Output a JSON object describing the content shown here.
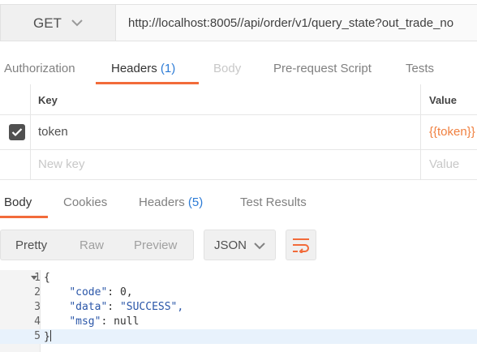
{
  "request": {
    "method": "GET",
    "url": "http://localhost:8005//api/order/v1/query_state?out_trade_no"
  },
  "request_tabs": [
    {
      "label": "Authorization"
    },
    {
      "label": "Headers",
      "count": "(1)"
    },
    {
      "label": "Body"
    },
    {
      "label": "Pre-request Script"
    },
    {
      "label": "Tests"
    }
  ],
  "headers_table": {
    "col_key": "Key",
    "col_value": "Value",
    "rows": [
      {
        "key": "token",
        "value": "{{token}}",
        "checked": true
      }
    ],
    "new_key_placeholder": "New key",
    "new_value_placeholder": "Value"
  },
  "response_tabs": [
    {
      "label": "Body"
    },
    {
      "label": "Cookies"
    },
    {
      "label": "Headers",
      "count": "(5)"
    },
    {
      "label": "Test Results"
    }
  ],
  "view_options": [
    "Pretty",
    "Raw",
    "Preview"
  ],
  "format": "JSON",
  "code_lines": [
    {
      "num": "1",
      "text": "{"
    },
    {
      "num": "2",
      "key": "\"code\"",
      "value": "0,"
    },
    {
      "num": "3",
      "key": "\"data\"",
      "value": "\"SUCCESS\","
    },
    {
      "num": "4",
      "key": "\"msg\"",
      "value": "null"
    },
    {
      "num": "5",
      "text": "}"
    }
  ],
  "colors": {
    "accent": "#f26b3a",
    "count_blue": "#2c7bd6",
    "variable_orange": "#f08040"
  },
  "icons": {
    "method_chevron": "chevron-down-icon",
    "format_chevron": "chevron-down-icon",
    "wrap": "wrap-lines-icon",
    "check": "check-icon",
    "fold": "fold-arrow-icon"
  }
}
